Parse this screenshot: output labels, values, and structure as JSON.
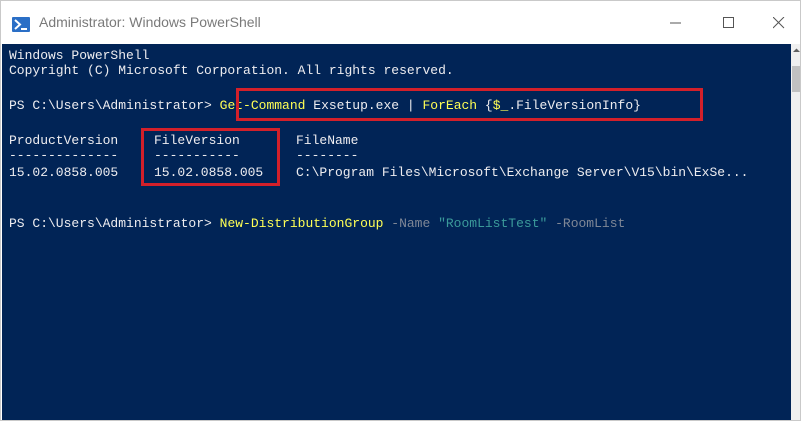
{
  "window": {
    "title": "Administrator: Windows PowerShell",
    "icon": "powershell-icon"
  },
  "controls": {
    "minimize": "minimize-icon",
    "maximize": "maximize-icon",
    "close": "close-icon"
  },
  "console": {
    "banner_line1": "Windows PowerShell",
    "banner_line2": "Copyright (C) Microsoft Corporation. All rights reserved.",
    "cmd1": {
      "prompt": "PS C:\\Users\\Administrator> ",
      "cmdlet": "Get-Command",
      "arg": " Exsetup.exe | ",
      "foreach": "ForEach",
      "block_open": " {",
      "var": "$_",
      "block_rest": ".FileVersionInfo}"
    },
    "table": {
      "headers": [
        "ProductVersion",
        "FileVersion",
        "FileName"
      ],
      "separators": [
        "--------------",
        "-----------",
        "--------"
      ],
      "row": [
        "15.02.0858.005",
        "15.02.0858.005",
        "C:\\Program Files\\Microsoft\\Exchange Server\\V15\\bin\\ExSe..."
      ]
    },
    "cmd2": {
      "prompt": "PS C:\\Users\\Administrator> ",
      "cmdlet": "New-DistributionGroup",
      "param1": " -Name ",
      "value1": "\"RoomListTest\"",
      "param2": " -RoomList"
    }
  },
  "colors": {
    "console_bg": "#012456",
    "text": "#eeedf0",
    "cmdlet": "#ffff55",
    "parameter": "#7f8796",
    "string": "#3b9a9a",
    "highlight": "#d3202a"
  }
}
